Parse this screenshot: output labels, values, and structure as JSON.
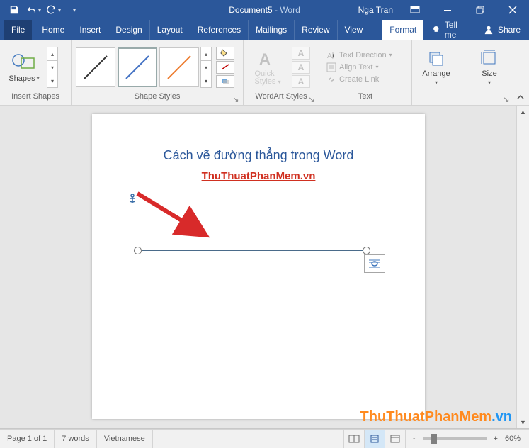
{
  "qat": {
    "save": "save",
    "undo": "undo",
    "redo": "redo"
  },
  "title": {
    "doc": "Document5",
    "suffix": " -  Word"
  },
  "user": {
    "name": "Nga Tran"
  },
  "window": {
    "ribbon_options": "Ribbon Display Options",
    "min": "Minimize",
    "max": "Restore",
    "close": "Close"
  },
  "tabs": {
    "file": "File",
    "home": "Home",
    "insert": "Insert",
    "design": "Design",
    "layout": "Layout",
    "references": "References",
    "mailings": "Mailings",
    "review": "Review",
    "view": "View",
    "format": "Format",
    "tellme": "Tell me",
    "share": "Share"
  },
  "ribbon": {
    "insert_shapes": {
      "shapes": "Shapes",
      "label": "Insert Shapes"
    },
    "shape_styles": {
      "label": "Shape Styles",
      "fill": "Shape Fill",
      "outline": "Shape Outline",
      "effects": "Shape Effects"
    },
    "wordart": {
      "quick": "Quick",
      "styles": "Styles",
      "label": "WordArt Styles"
    },
    "text": {
      "direction": "Text Direction",
      "align": "Align Text",
      "link": "Create Link",
      "label": "Text"
    },
    "arrange": {
      "label": "Arrange",
      "btn": "Arrange"
    },
    "size": {
      "label": "Size",
      "btn": "Size"
    },
    "collapse": "Collapse the Ribbon"
  },
  "document": {
    "heading": "Cách vẽ đường thẳng trong Word",
    "link": "ThuThuatPhanMem.vn"
  },
  "status": {
    "page": "Page 1 of 1",
    "words": "7 words",
    "lang": "Vietnamese",
    "zoom_out": "-",
    "zoom_in": "+",
    "zoom": "60%"
  },
  "watermark": {
    "a": "ThuThuatPhanMem",
    "b": ".vn"
  }
}
